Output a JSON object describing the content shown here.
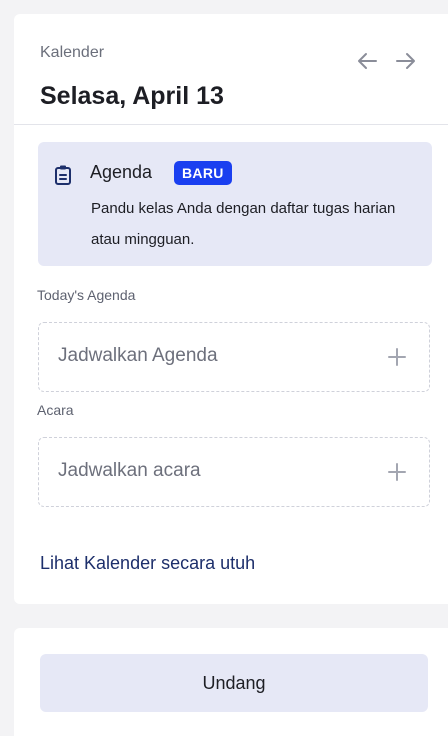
{
  "calendar": {
    "label": "Kalender",
    "date": "Selasa, April 13",
    "prev_icon": "arrow-left-icon",
    "next_icon": "arrow-right-icon"
  },
  "promo": {
    "icon": "clipboard-icon",
    "title": "Agenda",
    "badge": "BARU",
    "badge_color": "#1a3ff0",
    "description": "Pandu kelas Anda dengan daftar tugas harian atau mingguan.",
    "background": "#e6e8f6"
  },
  "agenda": {
    "label": "Today's Agenda",
    "placeholder": "Jadwalkan Agenda",
    "add_icon": "plus-icon"
  },
  "events": {
    "label": "Acara",
    "placeholder": "Jadwalkan acara",
    "add_icon": "plus-icon"
  },
  "full_calendar_link": "Lihat Kalender secara utuh",
  "invite_button": "Undang"
}
